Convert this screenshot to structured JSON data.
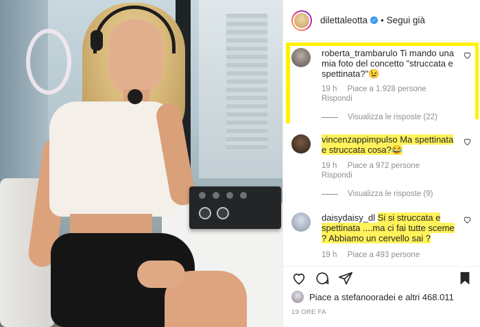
{
  "post": {
    "owner": {
      "username": "dilettaleotta",
      "verified": true,
      "follow_label": "Segui già",
      "separator": "•"
    },
    "comments": [
      {
        "username": "roberta_trambarulo",
        "text": "Ti mando una mia foto del concetto \"struccata e spettinata?\"😉",
        "time": "19 h",
        "likes": "Piace a 1.928 persone",
        "reply_label": "Rispondi",
        "view_replies": "Visualizza le risposte (22)"
      },
      {
        "username": "vincenzappimpulso",
        "text": "Ma spettinata e struccata cosa?😂",
        "time": "19 h",
        "likes": "Piace a 972 persone",
        "reply_label": "Rispondi",
        "view_replies": "Visualizza le risposte (9)"
      },
      {
        "username": "daisydaisy_dl",
        "text_a": "Si si struccata e spettinata ....ma ci fai tutte sceme ? Abbiamo un cervello sai ?",
        "time": "19 h",
        "likes": "Piace a 493 persone"
      }
    ],
    "likes_summary": "Piace a stefanooradei e altri 468.011",
    "time_ago": "19 ORE FA"
  },
  "icons": {
    "like": "heart-icon",
    "comment": "comment-icon",
    "share": "paper-plane-icon",
    "save": "bookmark-icon",
    "comment_like": "heart-outline-icon"
  },
  "colors": {
    "highlight": "#fff25a",
    "verified": "#3897f0",
    "muted_text": "#8e8e8e",
    "text": "#262626"
  }
}
